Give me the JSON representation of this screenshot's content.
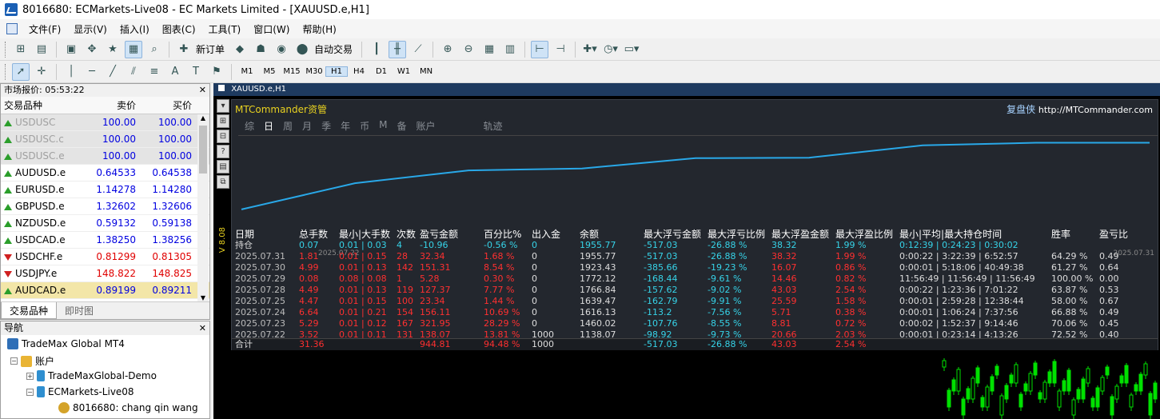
{
  "window": {
    "title": "8016680: ECMarkets-Live08 - EC Markets Limited - [XAUUSD.e,H1]"
  },
  "menu": [
    "文件(F)",
    "显示(V)",
    "插入(I)",
    "图表(C)",
    "工具(T)",
    "窗口(W)",
    "帮助(H)"
  ],
  "toolbar": {
    "new_order": "新订单",
    "auto_trade": "自动交易"
  },
  "timeframes": [
    "M1",
    "M5",
    "M15",
    "M30",
    "H1",
    "H4",
    "D1",
    "W1",
    "MN"
  ],
  "market_watch": {
    "title": "市场报价: 05:53:22",
    "headers": [
      "交易品种",
      "卖价",
      "买价"
    ],
    "rows": [
      {
        "s": "USDUSC",
        "bid": "100.00",
        "ask": "100.00",
        "st": "dis"
      },
      {
        "s": "USDUSC.c",
        "bid": "100.00",
        "ask": "100.00",
        "st": "dis"
      },
      {
        "s": "USDUSC.e",
        "bid": "100.00",
        "ask": "100.00",
        "st": "dis"
      },
      {
        "s": "AUDUSD.e",
        "bid": "0.64533",
        "ask": "0.64538",
        "st": "up"
      },
      {
        "s": "EURUSD.e",
        "bid": "1.14278",
        "ask": "1.14280",
        "st": "up"
      },
      {
        "s": "GBPUSD.e",
        "bid": "1.32602",
        "ask": "1.32606",
        "st": "up"
      },
      {
        "s": "NZDUSD.e",
        "bid": "0.59132",
        "ask": "0.59138",
        "st": "up"
      },
      {
        "s": "USDCAD.e",
        "bid": "1.38250",
        "ask": "1.38256",
        "st": "up"
      },
      {
        "s": "USDCHF.e",
        "bid": "0.81299",
        "ask": "0.81305",
        "st": "down"
      },
      {
        "s": "USDJPY.e",
        "bid": "148.822",
        "ask": "148.825",
        "st": "down"
      },
      {
        "s": "AUDCAD.e",
        "bid": "0.89199",
        "ask": "0.89211",
        "st": "sel"
      }
    ],
    "tabs": [
      "交易品种",
      "即时图"
    ]
  },
  "navigator": {
    "title": "导航",
    "items": [
      "TradeMax Global MT4",
      "账户",
      "TradeMaxGlobal-Demo",
      "ECMarkets-Live08",
      "8016680: chang qin wang"
    ]
  },
  "chart": {
    "title": "XAUUSD.e,H1",
    "vlabel": "V 8.08"
  },
  "panel": {
    "name": "MTCommander资管",
    "brand": "复盘侠",
    "url": "http://MTCommander.com",
    "tabs": [
      "综",
      "日",
      "周",
      "月",
      "季",
      "年",
      "币",
      "M",
      "备",
      "账户",
      "轨迹"
    ],
    "axis_start": "2025.07.22",
    "axis_end": "2025.07.31",
    "equity": [
      1138.07,
      1460.02,
      1616.13,
      1639.47,
      1766.84,
      1772.12,
      1923.43,
      1955.77,
      1955.77
    ],
    "headers": [
      "日期",
      "总手数",
      "最小|大手数",
      "次数",
      "盈亏金额",
      "百分比%",
      "出入金",
      "余额",
      "最大浮亏金额",
      "最大浮亏比例",
      "最大浮盈金额",
      "最大浮盈比例",
      "最小|平均|最大持仓时间",
      "胜率",
      "盈亏比"
    ],
    "hold": [
      "持仓",
      "0.07",
      "0.01 | 0.03",
      "4",
      "-10.96",
      "-0.56 %",
      "0",
      "1955.77",
      "-517.03",
      "-26.88 %",
      "38.32",
      "1.99 %",
      "0:12:39 | 0:24:23 | 0:30:02",
      "",
      ""
    ],
    "rows": [
      [
        "2025.07.31",
        "1.81",
        "0.01 | 0.15",
        "28",
        "32.34",
        "1.68 %",
        "0",
        "1955.77",
        "-517.03",
        "-26.88 %",
        "38.32",
        "1.99 %",
        "0:00:22 | 3:22:39 | 6:52:57",
        "64.29 %",
        "0.49"
      ],
      [
        "2025.07.30",
        "4.99",
        "0.01 | 0.13",
        "142",
        "151.31",
        "8.54 %",
        "0",
        "1923.43",
        "-385.66",
        "-19.23 %",
        "16.07",
        "0.86 %",
        "0:00:01 | 5:18:06 | 40:49:38",
        "61.27 %",
        "0.64"
      ],
      [
        "2025.07.29",
        "0.08",
        "0.08 | 0.08",
        "1",
        "5.28",
        "0.30 %",
        "0",
        "1772.12",
        "-168.44",
        "-9.61 %",
        "14.46",
        "0.82 %",
        "11:56:49 | 11:56:49 | 11:56:49",
        "100.00 %",
        "0.00"
      ],
      [
        "2025.07.28",
        "4.49",
        "0.01 | 0.13",
        "119",
        "127.37",
        "7.77 %",
        "0",
        "1766.84",
        "-157.62",
        "-9.02 %",
        "43.03",
        "2.54 %",
        "0:00:22 | 1:23:36 | 7:01:22",
        "63.87 %",
        "0.53"
      ],
      [
        "2025.07.25",
        "4.47",
        "0.01 | 0.15",
        "100",
        "23.34",
        "1.44 %",
        "0",
        "1639.47",
        "-162.79",
        "-9.91 %",
        "25.59",
        "1.58 %",
        "0:00:01 | 2:59:28 | 12:38:44",
        "58.00 %",
        "0.67"
      ],
      [
        "2025.07.24",
        "6.64",
        "0.01 | 0.21",
        "154",
        "156.11",
        "10.69 %",
        "0",
        "1616.13",
        "-113.2",
        "-7.56 %",
        "5.71",
        "0.38 %",
        "0:00:01 | 1:06:24 | 7:37:56",
        "66.88 %",
        "0.49"
      ],
      [
        "2025.07.23",
        "5.29",
        "0.01 | 0.12",
        "167",
        "321.95",
        "28.29 %",
        "0",
        "1460.02",
        "-107.76",
        "-8.55 %",
        "8.81",
        "0.72 %",
        "0:00:02 | 1:52:37 | 9:14:46",
        "70.06 %",
        "0.45"
      ],
      [
        "2025.07.22",
        "3.52",
        "0.01 | 0.11",
        "131",
        "138.07",
        "13.81 %",
        "1000",
        "1138.07",
        "-98.92",
        "-9.73 %",
        "20.66",
        "2.03 %",
        "0:00:01 | 0:23:14 | 4:13:26",
        "72.52 %",
        "0.40"
      ]
    ],
    "total": [
      "合计",
      "31.36",
      "",
      "",
      "944.81",
      "94.48 %",
      "1000",
      "",
      "-517.03",
      "-26.88 %",
      "43.03",
      "2.54 %",
      "",
      "",
      ""
    ]
  }
}
